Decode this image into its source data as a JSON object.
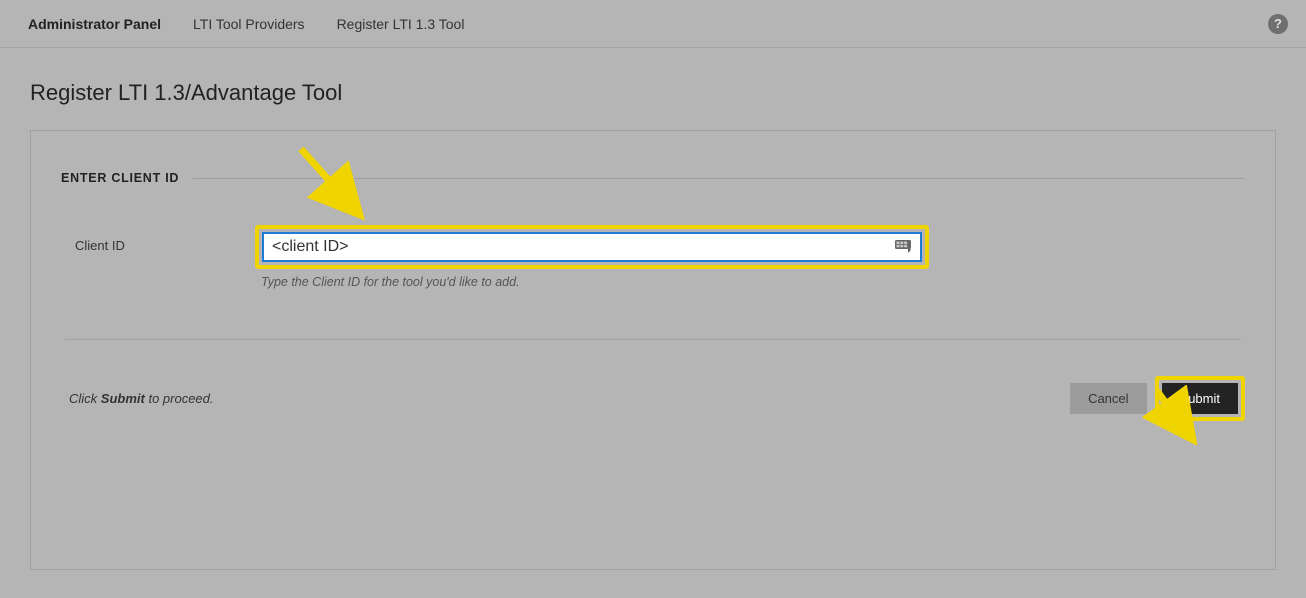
{
  "breadcrumb": {
    "items": [
      {
        "label": "Administrator Panel"
      },
      {
        "label": "LTI Tool Providers"
      },
      {
        "label": "Register LTI 1.3 Tool"
      }
    ]
  },
  "page_title": "Register LTI 1.3/Advantage Tool",
  "section": {
    "title": "ENTER CLIENT ID",
    "field_label": "Client ID",
    "input_value": "<client ID>",
    "help_text": "Type the Client ID for the tool you'd like to add."
  },
  "footer": {
    "prefix": "Click ",
    "strong": "Submit",
    "suffix": " to proceed.",
    "cancel_label": "Cancel",
    "submit_label": "Submit"
  },
  "icons": {
    "help": "?"
  }
}
